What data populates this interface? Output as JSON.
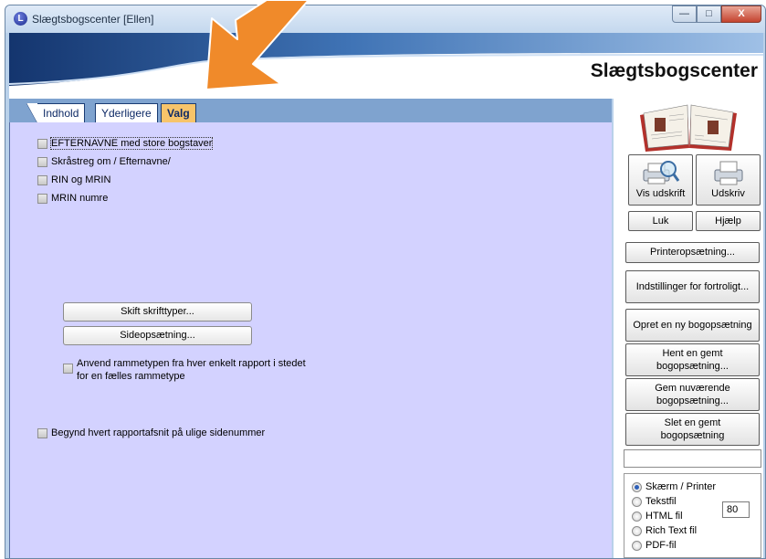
{
  "window": {
    "title": "Slægtsbogscenter [Ellen]",
    "icon_letter": "L",
    "minimize": "—",
    "maximize": "□",
    "close": "X"
  },
  "banner": {
    "title": "Slægtsbogscenter"
  },
  "tabs": [
    {
      "label": "Indhold"
    },
    {
      "label": "Yderligere"
    },
    {
      "label": "Valg",
      "active": true
    }
  ],
  "options": {
    "checkboxes": [
      {
        "label": "EFTERNAVNE med store bogstaver",
        "checked": false
      },
      {
        "label": "Skråstreg om / Efternavne/",
        "checked": false
      },
      {
        "label": "RIN og MRIN",
        "checked": false
      },
      {
        "label": "MRIN numre",
        "checked": false
      }
    ],
    "font_button": "Skift skrifttyper...",
    "page_setup_button": "Sideopsætning...",
    "frame_checkbox": "Anvend rammetypen fra hver enkelt rapport i stedet for en fælles rammetype",
    "odd_page_checkbox": "Begynd hvert rapportafsnit på ulige sidenummer"
  },
  "side": {
    "preview": "Vis udskrift",
    "print": "Udskriv",
    "close": "Luk",
    "help": "Hjælp",
    "printer_setup": "Printeropsætning...",
    "privacy": "Indstillinger for fortroligt...",
    "new_setup": "Opret en ny bogopsætning",
    "load_setup": "Hent en gemt bogopsætning...",
    "save_setup": "Gem nuværende bogopsætning...",
    "delete_setup": "Slet en gemt bogopsætning",
    "status": ""
  },
  "output": {
    "options": [
      "Skærm / Printer",
      "Tekstfil",
      "HTML fil",
      "Rich Text fil",
      "PDF-fil"
    ],
    "selected": "Skærm / Printer",
    "width_value": "80"
  },
  "colors": {
    "panel": "#d3d2ff",
    "tab_active": "#f7c46a",
    "arrow": "#f08a2a"
  }
}
